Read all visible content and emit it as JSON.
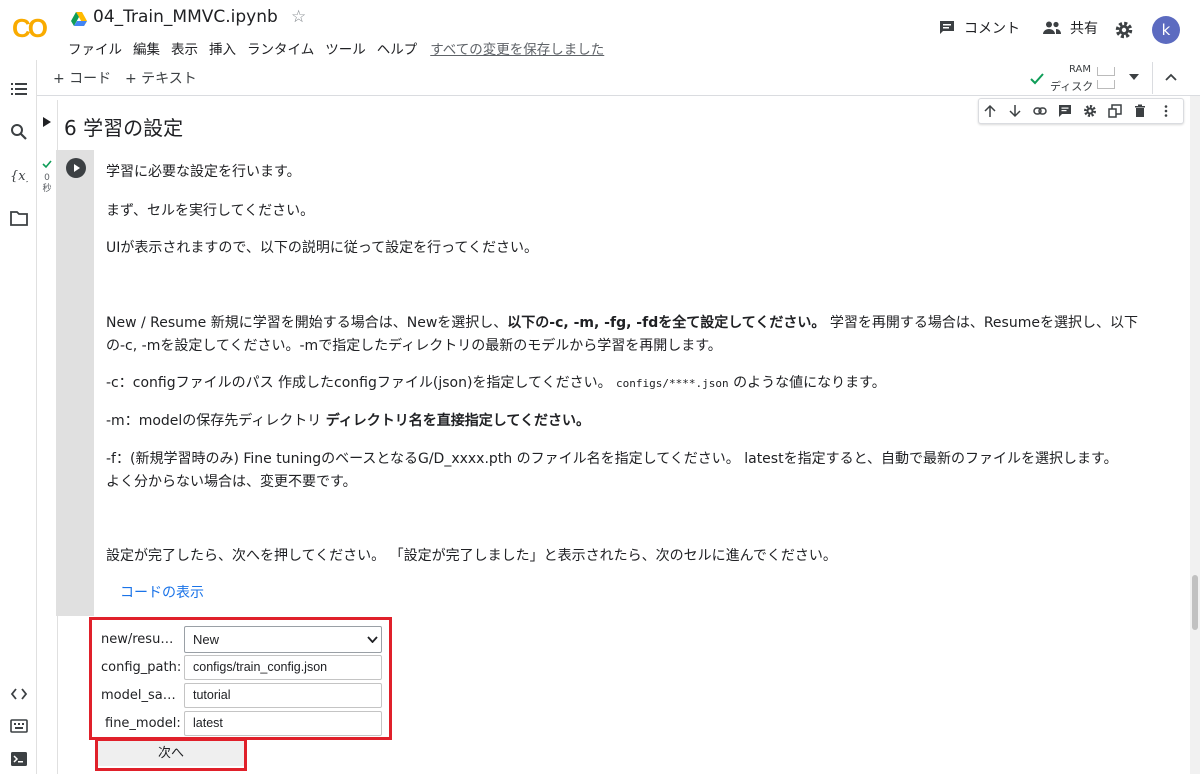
{
  "header": {
    "title": "04_Train_MMVC.ipynb",
    "logo_text": "CO",
    "menu": [
      "ファイル",
      "編集",
      "表示",
      "挿入",
      "ランタイム",
      "ツール",
      "ヘルプ"
    ],
    "saved_status": "すべての変更を保存しました",
    "comment_label": "コメント",
    "share_label": "共有",
    "avatar_letter": "k"
  },
  "toolbar": {
    "add_code": "+ コード",
    "add_text": "+ テキスト",
    "ram_label": "RAM",
    "disk_label": "ディスク"
  },
  "cell": {
    "section_title": "6 学習の設定",
    "exec_count": "0",
    "exec_unit": "秒",
    "lines": {
      "l1": "学習に必要な設定を行います。",
      "l2": "まず、セルを実行してください。",
      "l3": "UIが表示されますので、以下の説明に従って設定を行ってください。",
      "l4a": "New / Resume 新規に学習を開始する場合は、Newを選択し、",
      "l4b": "以下の-c, -m, -fg, -fdを全て設定してください。",
      "l4c": " 学習を再開する場合は、Resumeを選択し、以下",
      "l5": "の-c, -mを設定してください。-mで指定したディレクトリの最新のモデルから学習を再開します。",
      "l6a": "-c：configファイルのパス 作成したconfigファイル(json)を指定してください。 ",
      "l6code": "configs/****.json",
      "l6b": " のような値になります。",
      "l7a": "-m：modelの保存先ディレクトリ ",
      "l7b": "ディレクトリ名を直接指定してください。",
      "l8": "-f：(新規学習時のみ) Fine tuningのベースとなるG/D_xxxx.pth のファイル名を指定してください。 latestを指定すると、自動で最新のファイルを選択します。",
      "l9": "よく分からない場合は、変更不要です。",
      "l10": "設定が完了したら、次へを押してください。 「設定が完了しました」と表示されたら、次のセルに進んでください。"
    },
    "show_code": "コードの表示"
  },
  "form": {
    "mode_label": "new/resu…",
    "mode_value": "New",
    "config_label": "config_path:",
    "config_value": "configs/train_config.json",
    "model_label": "model_sa…",
    "model_value": "tutorial",
    "fine_label": "fine_model:",
    "fine_value": "latest",
    "next_label": "次へ"
  }
}
